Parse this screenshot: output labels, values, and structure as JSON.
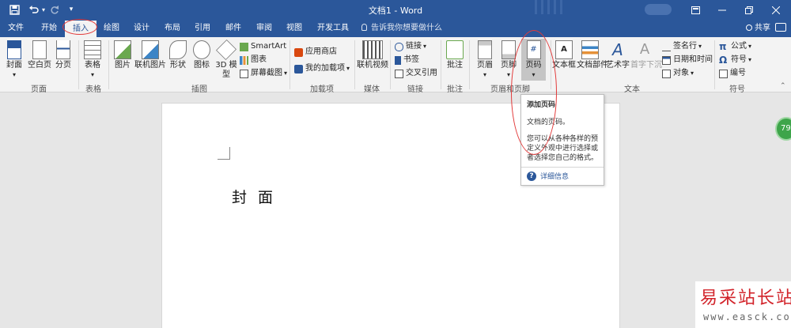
{
  "window": {
    "title": "文档1 - Word",
    "controls": {
      "ribbon_display": "ribbon-display-icon",
      "minimize": "minimize-icon",
      "restore": "restore-icon",
      "close": "close-icon"
    }
  },
  "quick_access": {
    "save": "save-icon",
    "undo": "undo-icon",
    "redo": "redo-icon",
    "customize": "customize-icon"
  },
  "tabs": [
    {
      "label": "文件"
    },
    {
      "label": "开始"
    },
    {
      "label": "插入",
      "active": true
    },
    {
      "label": "绘图"
    },
    {
      "label": "设计"
    },
    {
      "label": "布局"
    },
    {
      "label": "引用"
    },
    {
      "label": "邮件"
    },
    {
      "label": "审阅"
    },
    {
      "label": "视图"
    },
    {
      "label": "开发工具"
    }
  ],
  "tell_me": "告诉我你想要做什么",
  "share": "共享",
  "ribbon": {
    "pages": {
      "label": "页面",
      "cover": "封面",
      "blank": "空白页",
      "break": "分页"
    },
    "tables": {
      "label": "表格",
      "table": "表格"
    },
    "illustrations": {
      "label": "插图",
      "picture": "图片",
      "online_picture": "联机图片",
      "shapes": "形状",
      "icons": "图标",
      "model_3d_a": "3D 模",
      "model_3d_b": "型",
      "smartart": "SmartArt",
      "chart": "图表",
      "screenshot": "屏幕截图"
    },
    "addins": {
      "label": "加载项",
      "store": "应用商店",
      "my_addins": "我的加载项"
    },
    "media": {
      "label": "媒体",
      "online_video": "联机视频"
    },
    "links": {
      "label": "链接",
      "link": "链接",
      "bookmark": "书签",
      "cross_ref": "交叉引用"
    },
    "comments": {
      "label": "批注",
      "comment": "批注"
    },
    "header_footer": {
      "label": "页眉和页脚",
      "header": "页眉",
      "footer": "页脚",
      "page_number": "页码"
    },
    "text": {
      "label": "文本",
      "textbox": "文本框",
      "quick_parts": "文档部件",
      "wordart": "艺术字",
      "drop_cap": "首字下沉",
      "signature": "签名行",
      "datetime": "日期和时间",
      "object": "对象"
    },
    "symbols": {
      "label": "符号",
      "equation": "公式",
      "symbol": "符号",
      "number": "编号"
    }
  },
  "document": {
    "heading": "封面"
  },
  "tooltip": {
    "title": "添加页码",
    "line1": "文档的页码。",
    "desc": "您可以从各种各样的预定义外观中进行选择或者选择您自己的格式。",
    "link": "详细信息"
  },
  "side_badge": "79",
  "watermark": {
    "cn": "易采站长站",
    "en": "www.easck.com"
  },
  "colors": {
    "title_bar": "#2b579a",
    "ribbon": "#f3f3f3",
    "annotation": "#e23a3a",
    "accent": "#2b579a"
  }
}
